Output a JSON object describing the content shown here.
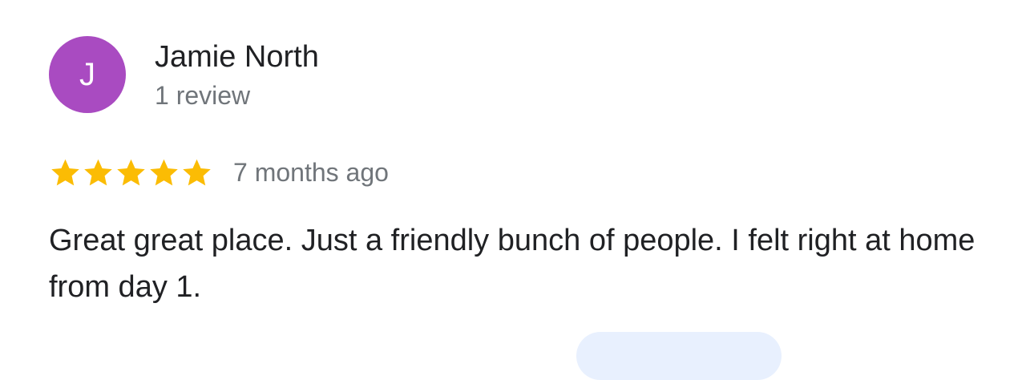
{
  "review": {
    "avatar_initial": "J",
    "avatar_color": "#a94bc1",
    "reviewer_name": "Jamie North",
    "reviewer_meta": "1 review",
    "rating": 5,
    "rating_max": 5,
    "star_icon": "star-icon",
    "star_color": "#fbbc04",
    "timestamp": "7 months ago",
    "text": "Great great place. Just a friendly bunch of people. I felt right at home from day 1."
  },
  "chip": {
    "color": "#e8f0fe"
  }
}
